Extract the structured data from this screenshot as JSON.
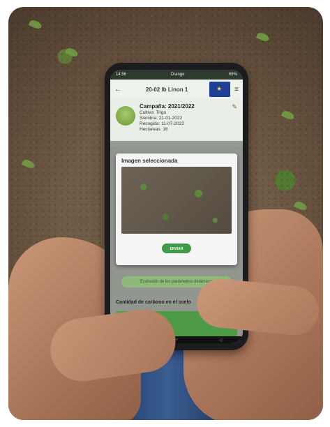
{
  "status_bar": {
    "time": "14:56",
    "carrier": "Orange",
    "battery": "69%"
  },
  "app_header": {
    "title": "20-02 Ib Linon 1"
  },
  "campaign": {
    "title": "Campaña: 2021/2022",
    "crop_line": "Cultivo: Trigo",
    "sowing_line": "Siembra: 21-01-2022",
    "harvest_line": "Recogida: 11-07-2022",
    "hectares_line": "Hectareas: 16"
  },
  "dialog": {
    "title": "Imagen seleccionada",
    "send_label": "ENVIAR"
  },
  "section_button": "Evolución de los parámetros dinámicos",
  "carbon_label": "Cantidad de carbono en el suelo",
  "colors": {
    "accent_green": "#3f9a4a",
    "header_blue": "#1f3f99"
  }
}
